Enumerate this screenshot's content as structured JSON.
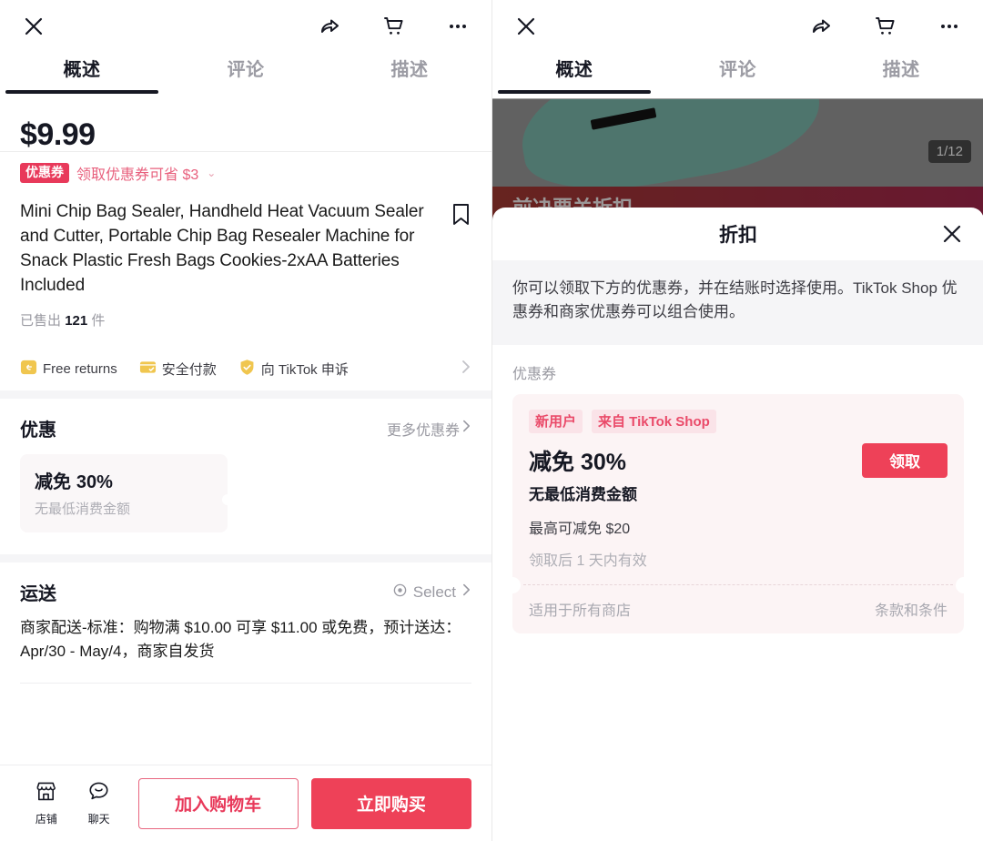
{
  "topbar": {
    "close_icon": "close-icon",
    "share_icon": "share-icon",
    "cart_icon": "cart-icon",
    "more_icon": "more-icon"
  },
  "tabs": [
    {
      "label": "概述",
      "active": true
    },
    {
      "label": "评论",
      "active": false
    },
    {
      "label": "描述",
      "active": false
    }
  ],
  "product": {
    "price": "$9.99",
    "coupon_tag": "优惠券",
    "coupon_text": "领取优惠券可省 $3",
    "coupon_caret": "⌄",
    "title": "Mini Chip Bag Sealer, Handheld Heat Vacuum Sealer and Cutter, Portable Chip Bag Resealer Machine for Snack Plastic Fresh Bags Cookies-2xAA Batteries Included",
    "sold_prefix": "已售出",
    "sold_count": "121",
    "sold_suffix": "件",
    "bookmark_icon": "bookmark-icon"
  },
  "badges": [
    {
      "label": "Free returns",
      "icon": "return-box-icon"
    },
    {
      "label": "安全付款",
      "icon": "secure-payment-icon"
    },
    {
      "label": "向 TikTok 申诉",
      "icon": "shield-check-icon"
    }
  ],
  "offers": {
    "title": "优惠",
    "more_label": "更多优惠券",
    "card": {
      "amount_prefix": "减免",
      "amount": "30%",
      "subtitle": "无最低消费金额"
    }
  },
  "shipping": {
    "title": "运送",
    "select_label": "Select",
    "location_icon": "location-pin-icon",
    "description": "商家配送-标准：购物满 $10.00 可享 $11.00 或免费，预计送达：Apr/30 - May/4，商家自发货"
  },
  "bottombar": {
    "shop_label": "店铺",
    "shop_icon": "storefront-icon",
    "chat_label": "聊天",
    "chat_icon": "chat-bubble-icon",
    "add_to_cart": "加入购物车",
    "buy_now": "立即购买"
  },
  "right_panel": {
    "hero_count": "1/12",
    "banner_text": "前决要关折扣",
    "modal": {
      "title": "折扣",
      "close_icon": "close-icon",
      "note": "你可以领取下方的优惠券，并在结账时选择使用。TikTok Shop 优惠券和商家优惠券可以组合使用。",
      "section_label": "优惠券",
      "coupon": {
        "tag_new_user": "新用户",
        "tag_source": "来自 TikTok Shop",
        "amount_prefix": "减免",
        "amount": "30%",
        "subtitle": "无最低消费金额",
        "max_discount": "最高可减免 $20",
        "validity": "领取后 1 天内有效",
        "claim_button": "领取",
        "scope": "适用于所有商店",
        "terms": "条款和条件"
      }
    }
  },
  "colors": {
    "brand_red": "#ee4158",
    "coupon_red": "#e8395a",
    "accent_pink": "#e8607d",
    "text_primary": "#161823",
    "text_muted": "#9a9aa2"
  }
}
